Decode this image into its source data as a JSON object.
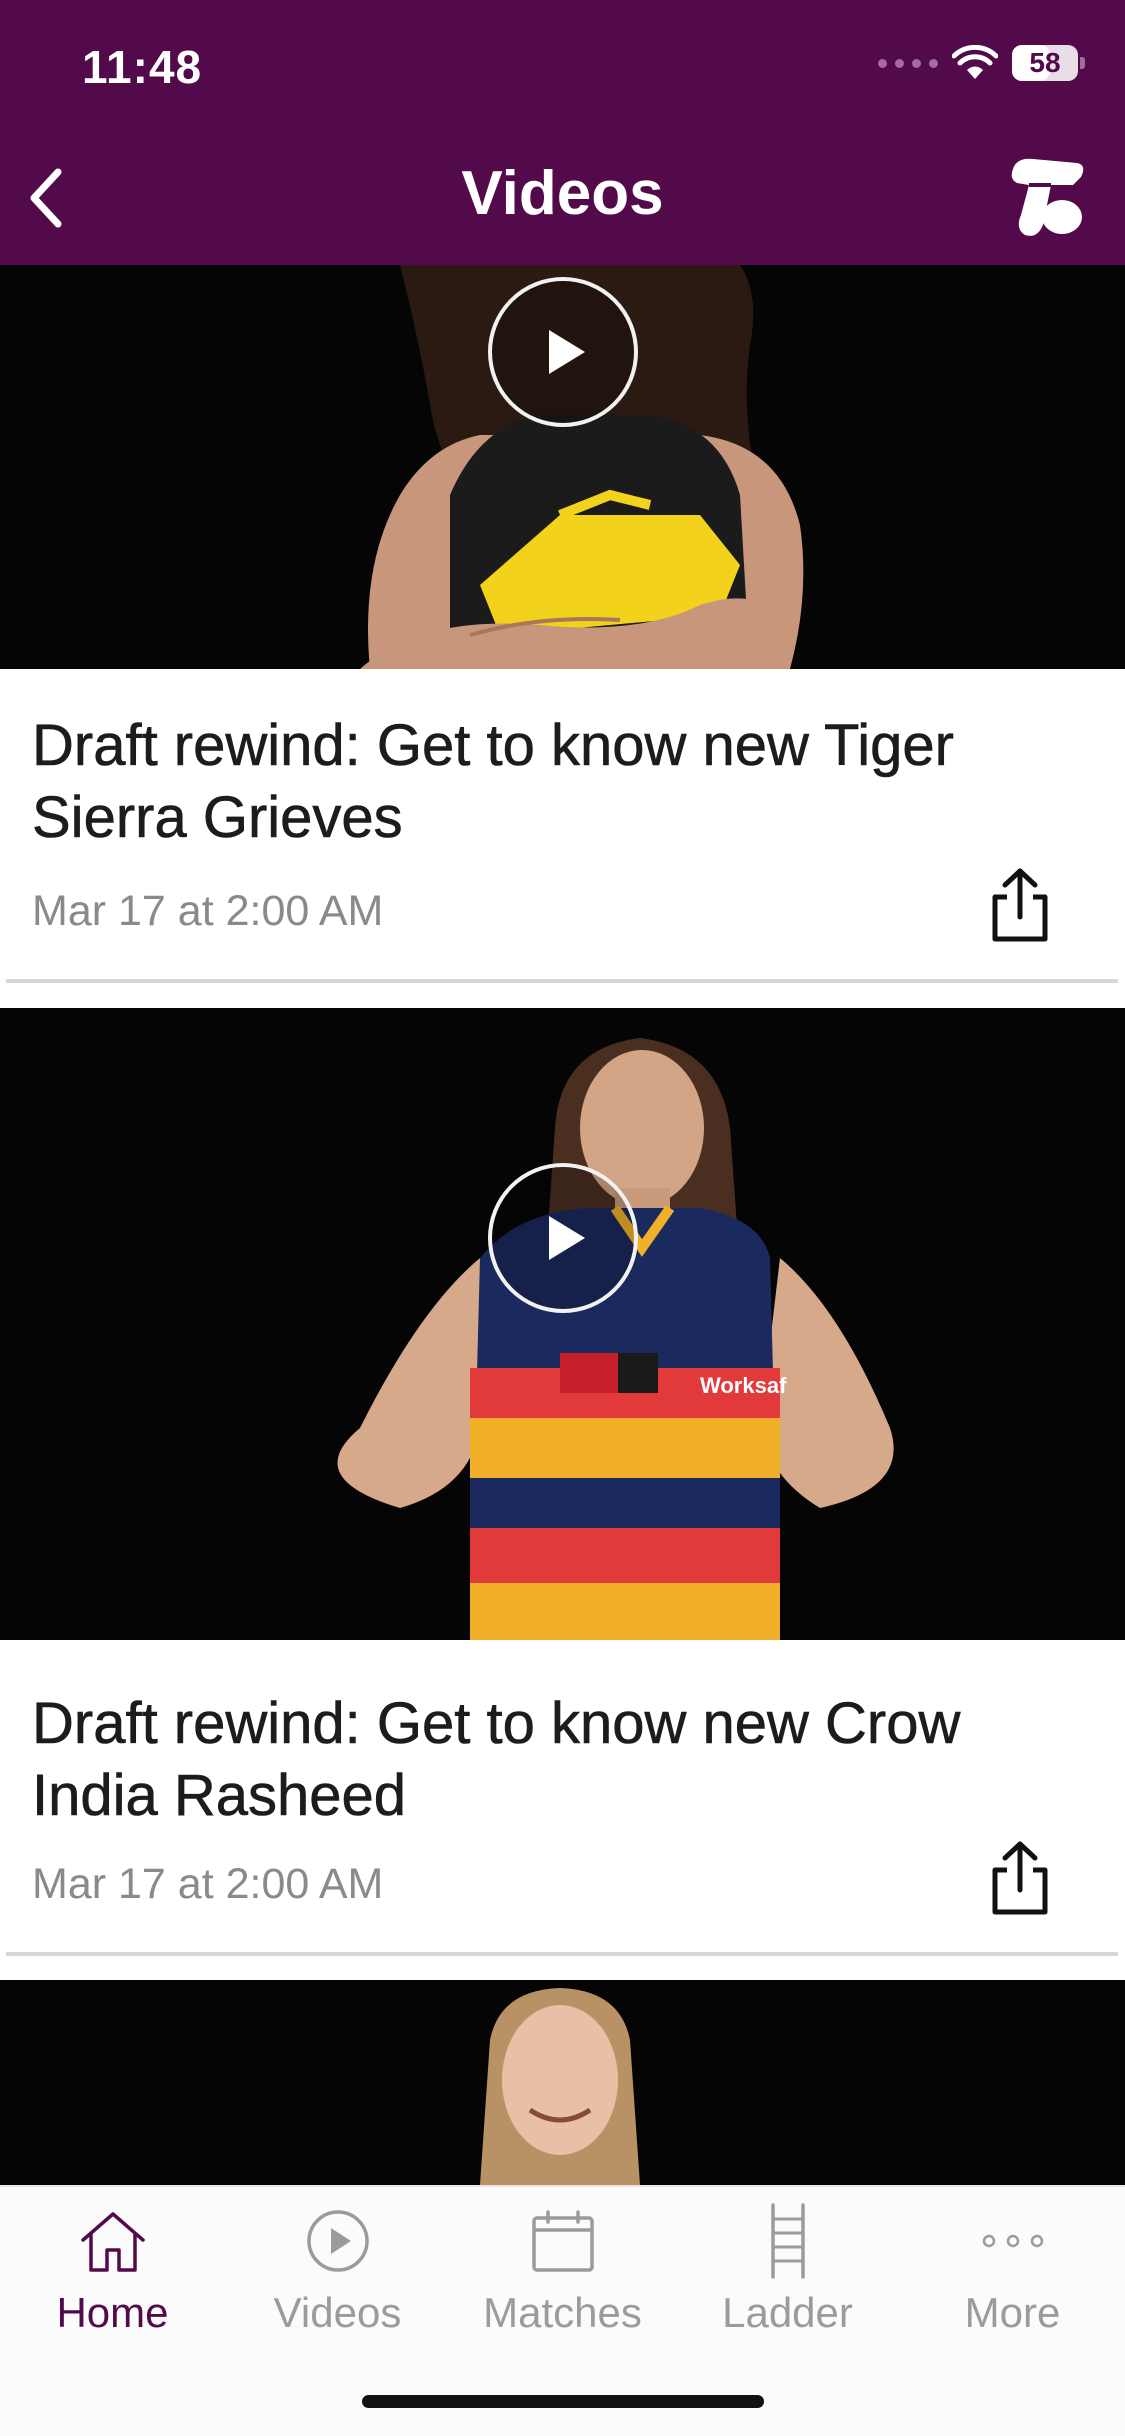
{
  "status_bar": {
    "time": "11:48",
    "battery": "58",
    "battery_level": 0.58
  },
  "header": {
    "title": "Videos",
    "back_icon": "chevron-left-icon",
    "brand_icon": "telstra-logo-icon"
  },
  "videos": [
    {
      "title": "Draft rewind: Get to know new Tiger Sierra Grieves",
      "date": "Mar 17 at 2:00 AM"
    },
    {
      "title": "Draft rewind: Get to know new Crow India Rasheed",
      "date": "Mar 17 at 2:00 AM"
    }
  ],
  "tabs": [
    {
      "label": "Home",
      "icon": "home-icon",
      "active": true
    },
    {
      "label": "Videos",
      "icon": "play-circle-icon",
      "active": false
    },
    {
      "label": "Matches",
      "icon": "calendar-icon",
      "active": false
    },
    {
      "label": "Ladder",
      "icon": "ladder-icon",
      "active": false
    },
    {
      "label": "More",
      "icon": "more-dots-icon",
      "active": false
    }
  ],
  "colors": {
    "brand_purple": "#530a4a",
    "inactive_gray": "#9b9b9f",
    "date_gray": "#8a8a8e"
  }
}
